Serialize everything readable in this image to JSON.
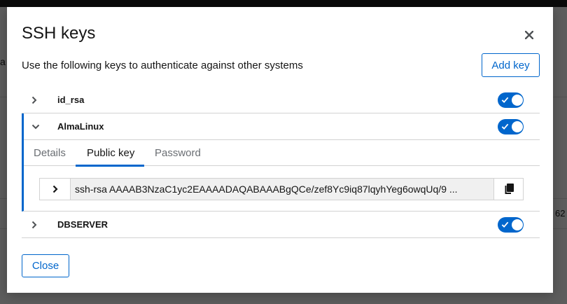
{
  "background": {
    "left_fragment": "a",
    "right_fragment": "62"
  },
  "modal": {
    "title": "SSH keys",
    "description": "Use the following keys to authenticate against other systems",
    "add_key_label": "Add key",
    "close_label": "Close"
  },
  "keys": [
    {
      "name": "id_rsa",
      "enabled": true,
      "expanded": false
    },
    {
      "name": "AlmaLinux",
      "enabled": true,
      "expanded": true,
      "tabs": [
        "Details",
        "Public key",
        "Password"
      ],
      "active_tab": "Public key",
      "public_key": "ssh-rsa AAAAB3NzaC1yc2EAAAADAQABAAABgQCe/zef8Yc9iq87lqyhYeg6owqUq/9 ..."
    },
    {
      "name": "DBSERVER",
      "enabled": true,
      "expanded": false
    }
  ],
  "colors": {
    "accent": "#0066cc",
    "text": "#151515",
    "muted": "#6a6e73",
    "border": "#d2d2d2"
  }
}
